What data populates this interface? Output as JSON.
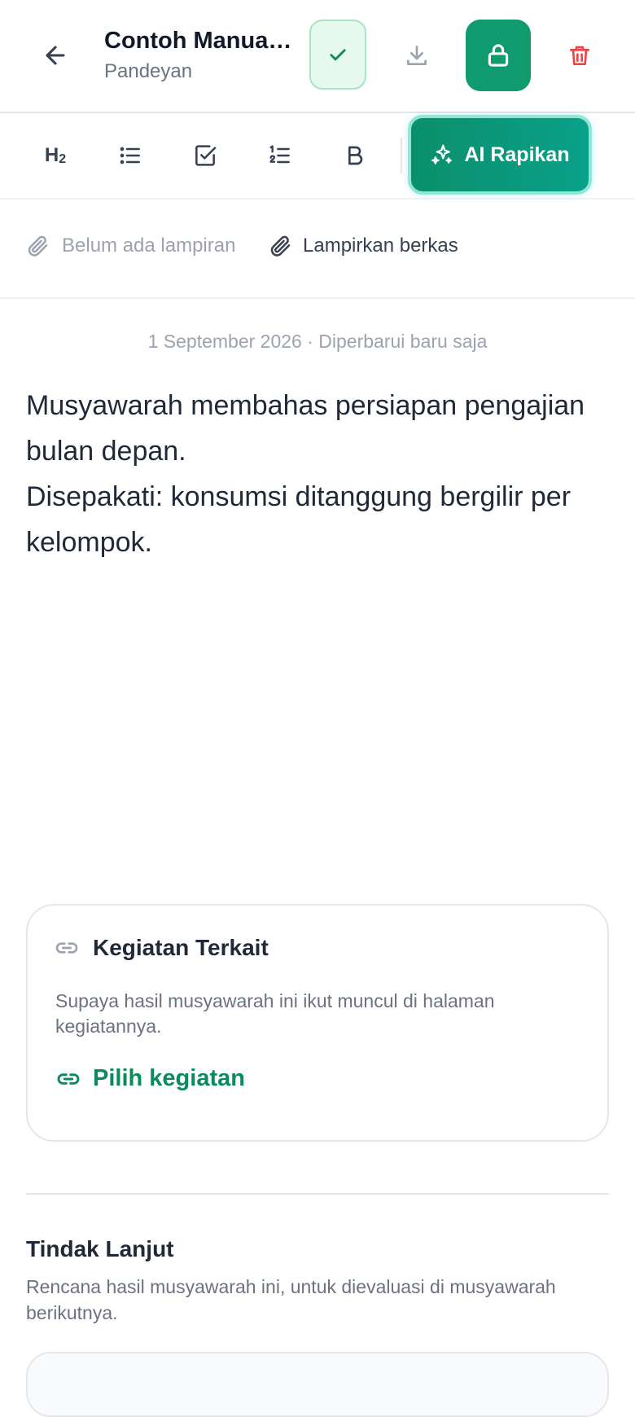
{
  "header": {
    "title": "Contoh Manual ...",
    "subtitle": "Pandeyan",
    "icons": {
      "back": "arrow-left-icon",
      "save": "check-icon",
      "download": "download-icon",
      "lock": "lock-icon",
      "delete": "trash-icon"
    }
  },
  "toolbar": {
    "heading_label": "H",
    "heading_sub": "2",
    "ai_button_label": "AI Rapikan",
    "icons": [
      "bullet-list-icon",
      "checkbox-icon",
      "numbered-list-icon",
      "bold-icon",
      "sparkle-icon"
    ]
  },
  "attachments": {
    "empty_label": "Belum ada lampiran",
    "attach_button_label": "Lampirkan berkas"
  },
  "note": {
    "meta": "1 September 2026 · Diperbarui baru saja",
    "lines": [
      "Musyawarah membahas persiapan pengajian bulan depan.",
      "Disepakati: konsumsi ditanggung bergilir per kelompok."
    ]
  },
  "related_activity": {
    "title": "Kegiatan Terkait",
    "description": "Supaya hasil musyawarah ini ikut muncul di halaman kegiatannya.",
    "link_label": "Pilih kegiatan"
  },
  "follow_up": {
    "title": "Tindak Lanjut",
    "description": "Rencana hasil musyawarah ini, untuk dievaluasi di musyawarah berikutnya."
  },
  "colors": {
    "accent": "#0f9b6e",
    "accent_light": "#e7f8ef",
    "danger": "#ef4444",
    "muted_text": "#9ca3af"
  }
}
